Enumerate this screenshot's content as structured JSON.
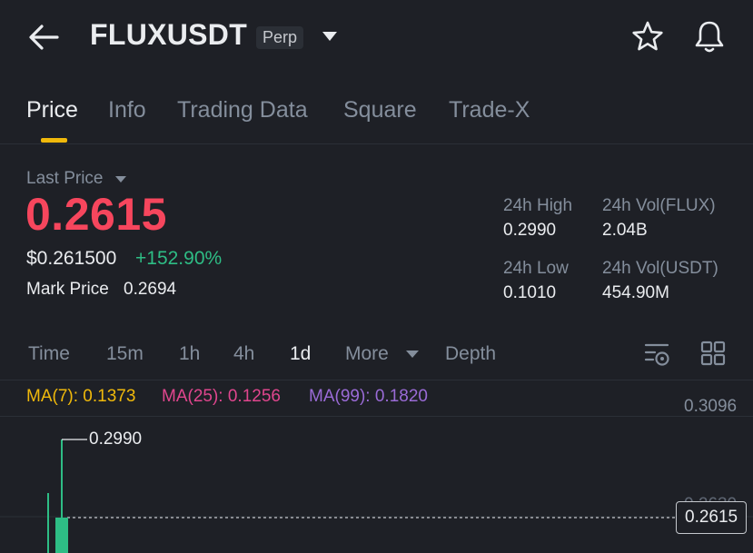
{
  "header": {
    "symbol": "FLUXUSDT",
    "contract_type": "Perp",
    "icons": {
      "back": "back-arrow-icon",
      "dropdown": "caret-down-icon",
      "favorite": "star-icon",
      "alerts": "bell-icon"
    }
  },
  "tabs": [
    {
      "label": "Price",
      "active": true
    },
    {
      "label": "Info",
      "active": false
    },
    {
      "label": "Trading Data",
      "active": false
    },
    {
      "label": "Square",
      "active": false
    },
    {
      "label": "Trade-X",
      "active": false
    }
  ],
  "price": {
    "last_label": "Last Price",
    "last": "0.2615",
    "usd": "$0.261500",
    "change_pct": "+152.90%",
    "mark_label": "Mark Price",
    "mark": "0.2694"
  },
  "stats": {
    "high_label": "24h High",
    "high": "0.2990",
    "low_label": "24h Low",
    "low": "0.1010",
    "vol_base_label": "24h Vol(FLUX)",
    "vol_base": "2.04B",
    "vol_quote_label": "24h Vol(USDT)",
    "vol_quote": "454.90M"
  },
  "intervals": [
    {
      "label": "Time",
      "active": false
    },
    {
      "label": "15m",
      "active": false
    },
    {
      "label": "1h",
      "active": false
    },
    {
      "label": "4h",
      "active": false
    },
    {
      "label": "1d",
      "active": true
    },
    {
      "label": "More",
      "active": false
    },
    {
      "label": "Depth",
      "active": false
    }
  ],
  "moving_averages": [
    {
      "label": "MA(7): 0.1373",
      "color": "#f0b90b"
    },
    {
      "label": "MA(25): 0.1256",
      "color": "#e0468e"
    },
    {
      "label": "MA(99): 0.1820",
      "color": "#9a6bd6"
    }
  ],
  "chart": {
    "axis_top": "0.3096",
    "axis_partial": "0.2630",
    "high_annotation": "0.2990",
    "current_price": "0.2615"
  },
  "colors": {
    "background": "#1e2026",
    "accent": "#f0b90b",
    "down": "#f6465d",
    "up": "#2ebd85",
    "muted": "#848e9c"
  }
}
